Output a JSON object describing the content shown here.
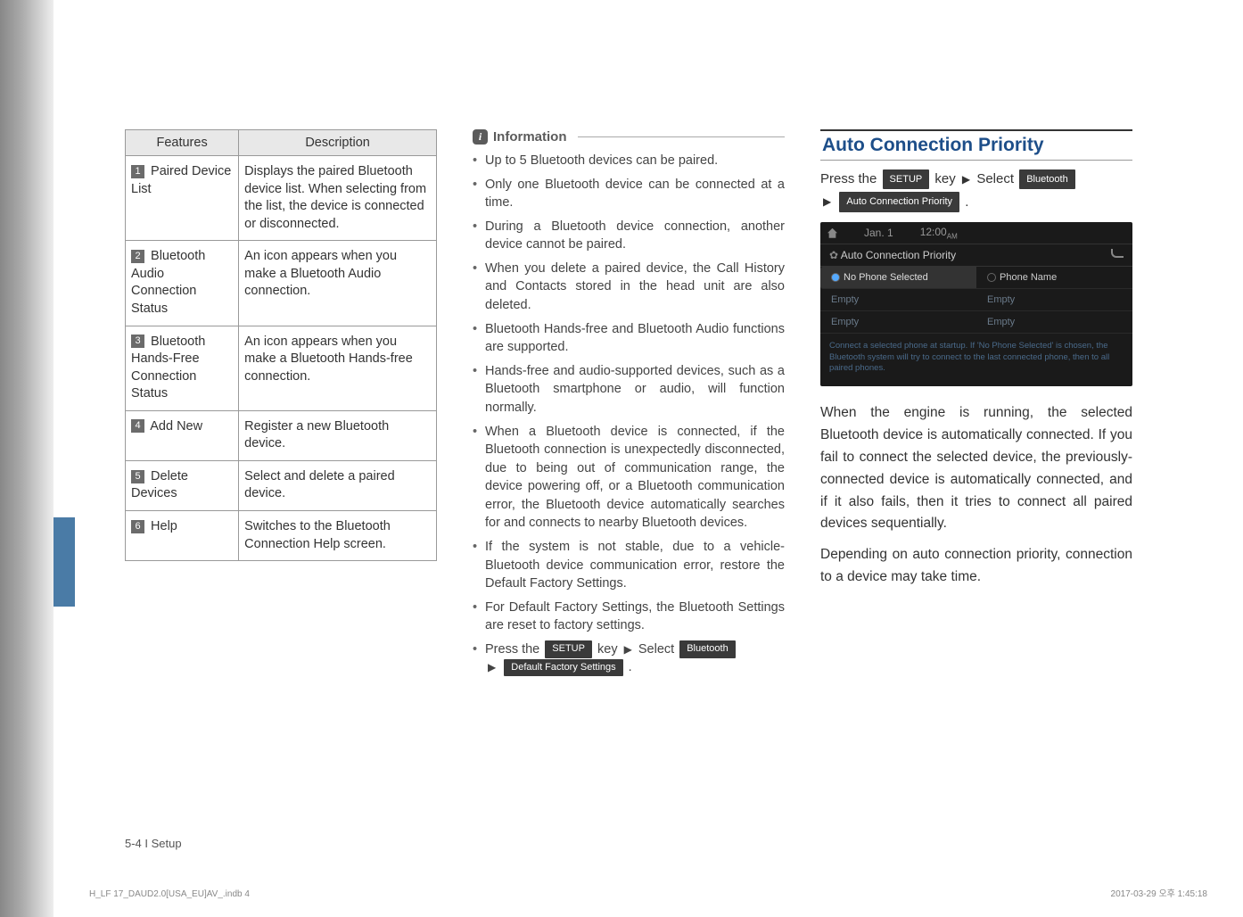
{
  "table": {
    "headers": {
      "col1": "Features",
      "col2": "Description"
    },
    "rows": [
      {
        "num": "1",
        "feature": "Paired Device List",
        "desc": "Displays the paired Bluetooth device list. When selecting from the list, the device is connected or disconnected."
      },
      {
        "num": "2",
        "feature": "Bluetooth Audio Connection Status",
        "desc": "An icon appears when you make a Bluetooth Audio connection."
      },
      {
        "num": "3",
        "feature": "Bluetooth Hands-Free Connection Status",
        "desc": "An icon appears when you make a Bluetooth Hands-free connection."
      },
      {
        "num": "4",
        "feature": "Add New",
        "desc": "Register a new Bluetooth device."
      },
      {
        "num": "5",
        "feature": "Delete Devices",
        "desc": "Select and delete a paired device."
      },
      {
        "num": "6",
        "feature": "Help",
        "desc": "Switches to the Bluetooth Connection Help screen."
      }
    ]
  },
  "info": {
    "heading": "Information",
    "items": [
      "Up to 5 Bluetooth devices can be paired.",
      "Only one Bluetooth device can be connected at a time.",
      "During a Bluetooth device connection, another device cannot be paired.",
      "When you delete a paired device, the Call History and Contacts stored in the head unit are also deleted.",
      "Bluetooth Hands-free and Bluetooth Audio functions are supported.",
      "Hands-free and audio-supported devices, such as a Bluetooth smartphone or audio, will function normally.",
      "When a Bluetooth device is connected, if the Bluetooth connection is unexpectedly disconnected, due to being out of communication range, the device powering off, or a Bluetooth communication error, the Bluetooth device automatically searches for and connects to nearby Bluetooth devices.",
      "If the system is not stable, due to a vehicle-Bluetooth device communication error, restore the Default Factory Settings.",
      "For Default Factory Settings, the Bluetooth Settings are reset to factory settings."
    ],
    "pressPrefix": "Press the",
    "keySetup": "SETUP",
    "keyWord": "key",
    "selectWord": "Select",
    "keyBluetooth": "Bluetooth",
    "keyDefault": "Default Factory Settings"
  },
  "col3": {
    "title": "Auto Connection Priority",
    "press": {
      "prefix": "Press the",
      "setup": "SETUP",
      "keyword": "key",
      "select": "Select",
      "bluetooth": "Bluetooth",
      "autoprio": "Auto Connection Priority"
    },
    "screenshot": {
      "date": "Jan. 1",
      "time": "12:00",
      "ampm": "AM",
      "title": "Auto Connection Priority",
      "leftHead": "No Phone Selected",
      "rightHead": "Phone Name",
      "empty": "Empty",
      "footer": "Connect a selected phone at startup. If 'No Phone Selected' is chosen, the Bluetooth system will try to connect to the last connected phone, then to all paired phones."
    },
    "body1": "When the engine is running, the selected Bluetooth device is automatically connected. If you fail to connect the selected device, the previously-connected device is automatically connected, and if it also fails, then it tries to connect all paired devices sequentially.",
    "body2": "Depending on auto connection priority, connection to a device may take time."
  },
  "footer": {
    "pageref": "5-4 I Setup",
    "printLeft": "H_LF 17_DAUD2.0[USA_EU]AV_.indb   4",
    "printRight": "2017-03-29   오후 1:45:18"
  }
}
